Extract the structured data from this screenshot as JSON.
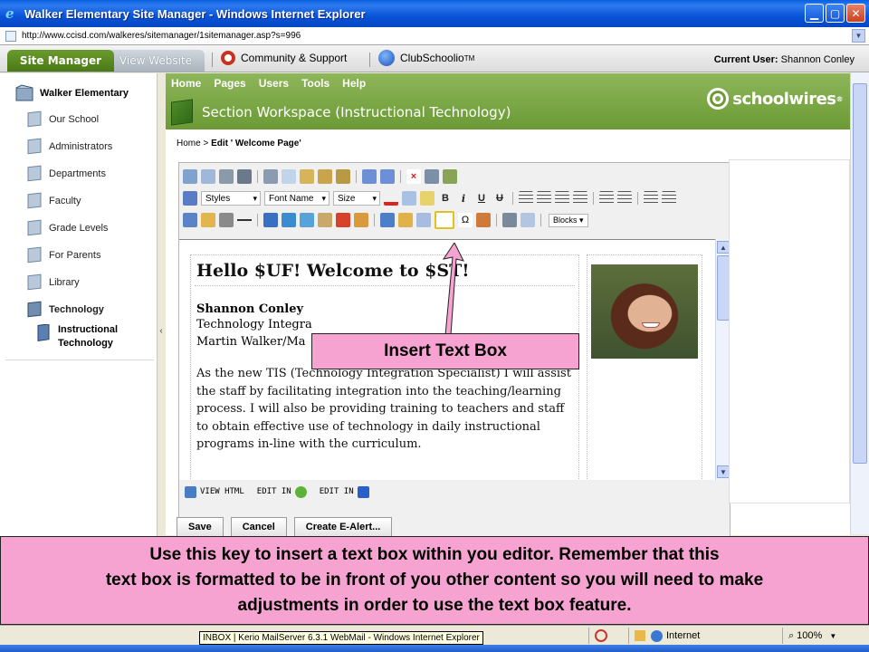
{
  "window": {
    "title": "Walker Elementary Site Manager - Windows Internet Explorer",
    "url": "http://www.ccisd.com/walkeres/sitemanager/1sitemanager.asp?s=996"
  },
  "topnav": {
    "tab_site_manager": "Site Manager",
    "tab_view_website": "View Website",
    "support": "Community & Support",
    "club": "ClubSchoolio",
    "club_tm": "TM",
    "user_label": "Current User:",
    "user_name": "Shannon Conley"
  },
  "sidebar": {
    "root": "Walker Elementary",
    "items": [
      {
        "label": "Our School"
      },
      {
        "label": "Administrators"
      },
      {
        "label": "Departments"
      },
      {
        "label": "Faculty"
      },
      {
        "label": "Grade Levels"
      },
      {
        "label": "For Parents"
      },
      {
        "label": "Library"
      },
      {
        "label": "Technology"
      }
    ],
    "sub_item_line1": "Instructional",
    "sub_item_line2": "Technology"
  },
  "main": {
    "menu": [
      "Home",
      "Pages",
      "Users",
      "Tools",
      "Help"
    ],
    "workspace_title": "Section Workspace",
    "workspace_sub": "(Instructional Technology)",
    "brand": "schoolwires",
    "brand_reg": "®",
    "breadcrumb_home": "Home",
    "breadcrumb_sep": ">",
    "breadcrumb_current": "Edit ' Welcome Page'"
  },
  "editor": {
    "styles": "Styles",
    "fontname": "Font Name",
    "size": "Size",
    "blocks": "Blocks",
    "format_bold": "B",
    "format_italic": "i",
    "format_underline": "U",
    "format_strike": "U",
    "heading": "Hello $UF! Welcome to $ST!",
    "name": "Shannon Conley",
    "sub1": "Technology Integra",
    "sub2": "Martin Walker/Ma",
    "paragraph": "As the new TIS (Technology Integration Specialist) I will assist the staff by facilitating integration into the teaching/learning process. I will also be providing training to teachers and staff to obtain effective use of technology in daily instructional programs in-line with the curriculum.",
    "mode_view_html": "VIEW HTML",
    "mode_edit_in_1": "EDIT IN",
    "mode_edit_in_2": "EDIT IN"
  },
  "buttons": {
    "save": "Save",
    "cancel": "Cancel",
    "alert": "Create E-Alert..."
  },
  "callouts": {
    "small": "Insert Text Box",
    "big_line1": "Use this key to insert a text box within you editor.  Remember that this",
    "big_line2": "text box is formatted to be in front of you other content so you will need to make",
    "big_line3": "adjustments in order to use the text box feature."
  },
  "statusbar": {
    "tooltip": "INBOX | Kerio MailServer 6.3.1 WebMail - Windows Internet Explorer",
    "zone": "Internet",
    "zoom": "100%"
  },
  "colors": {
    "green": "#6b9a35",
    "callout_pink": "#f6a3d2",
    "titlebar_blue": "#0853d8"
  }
}
